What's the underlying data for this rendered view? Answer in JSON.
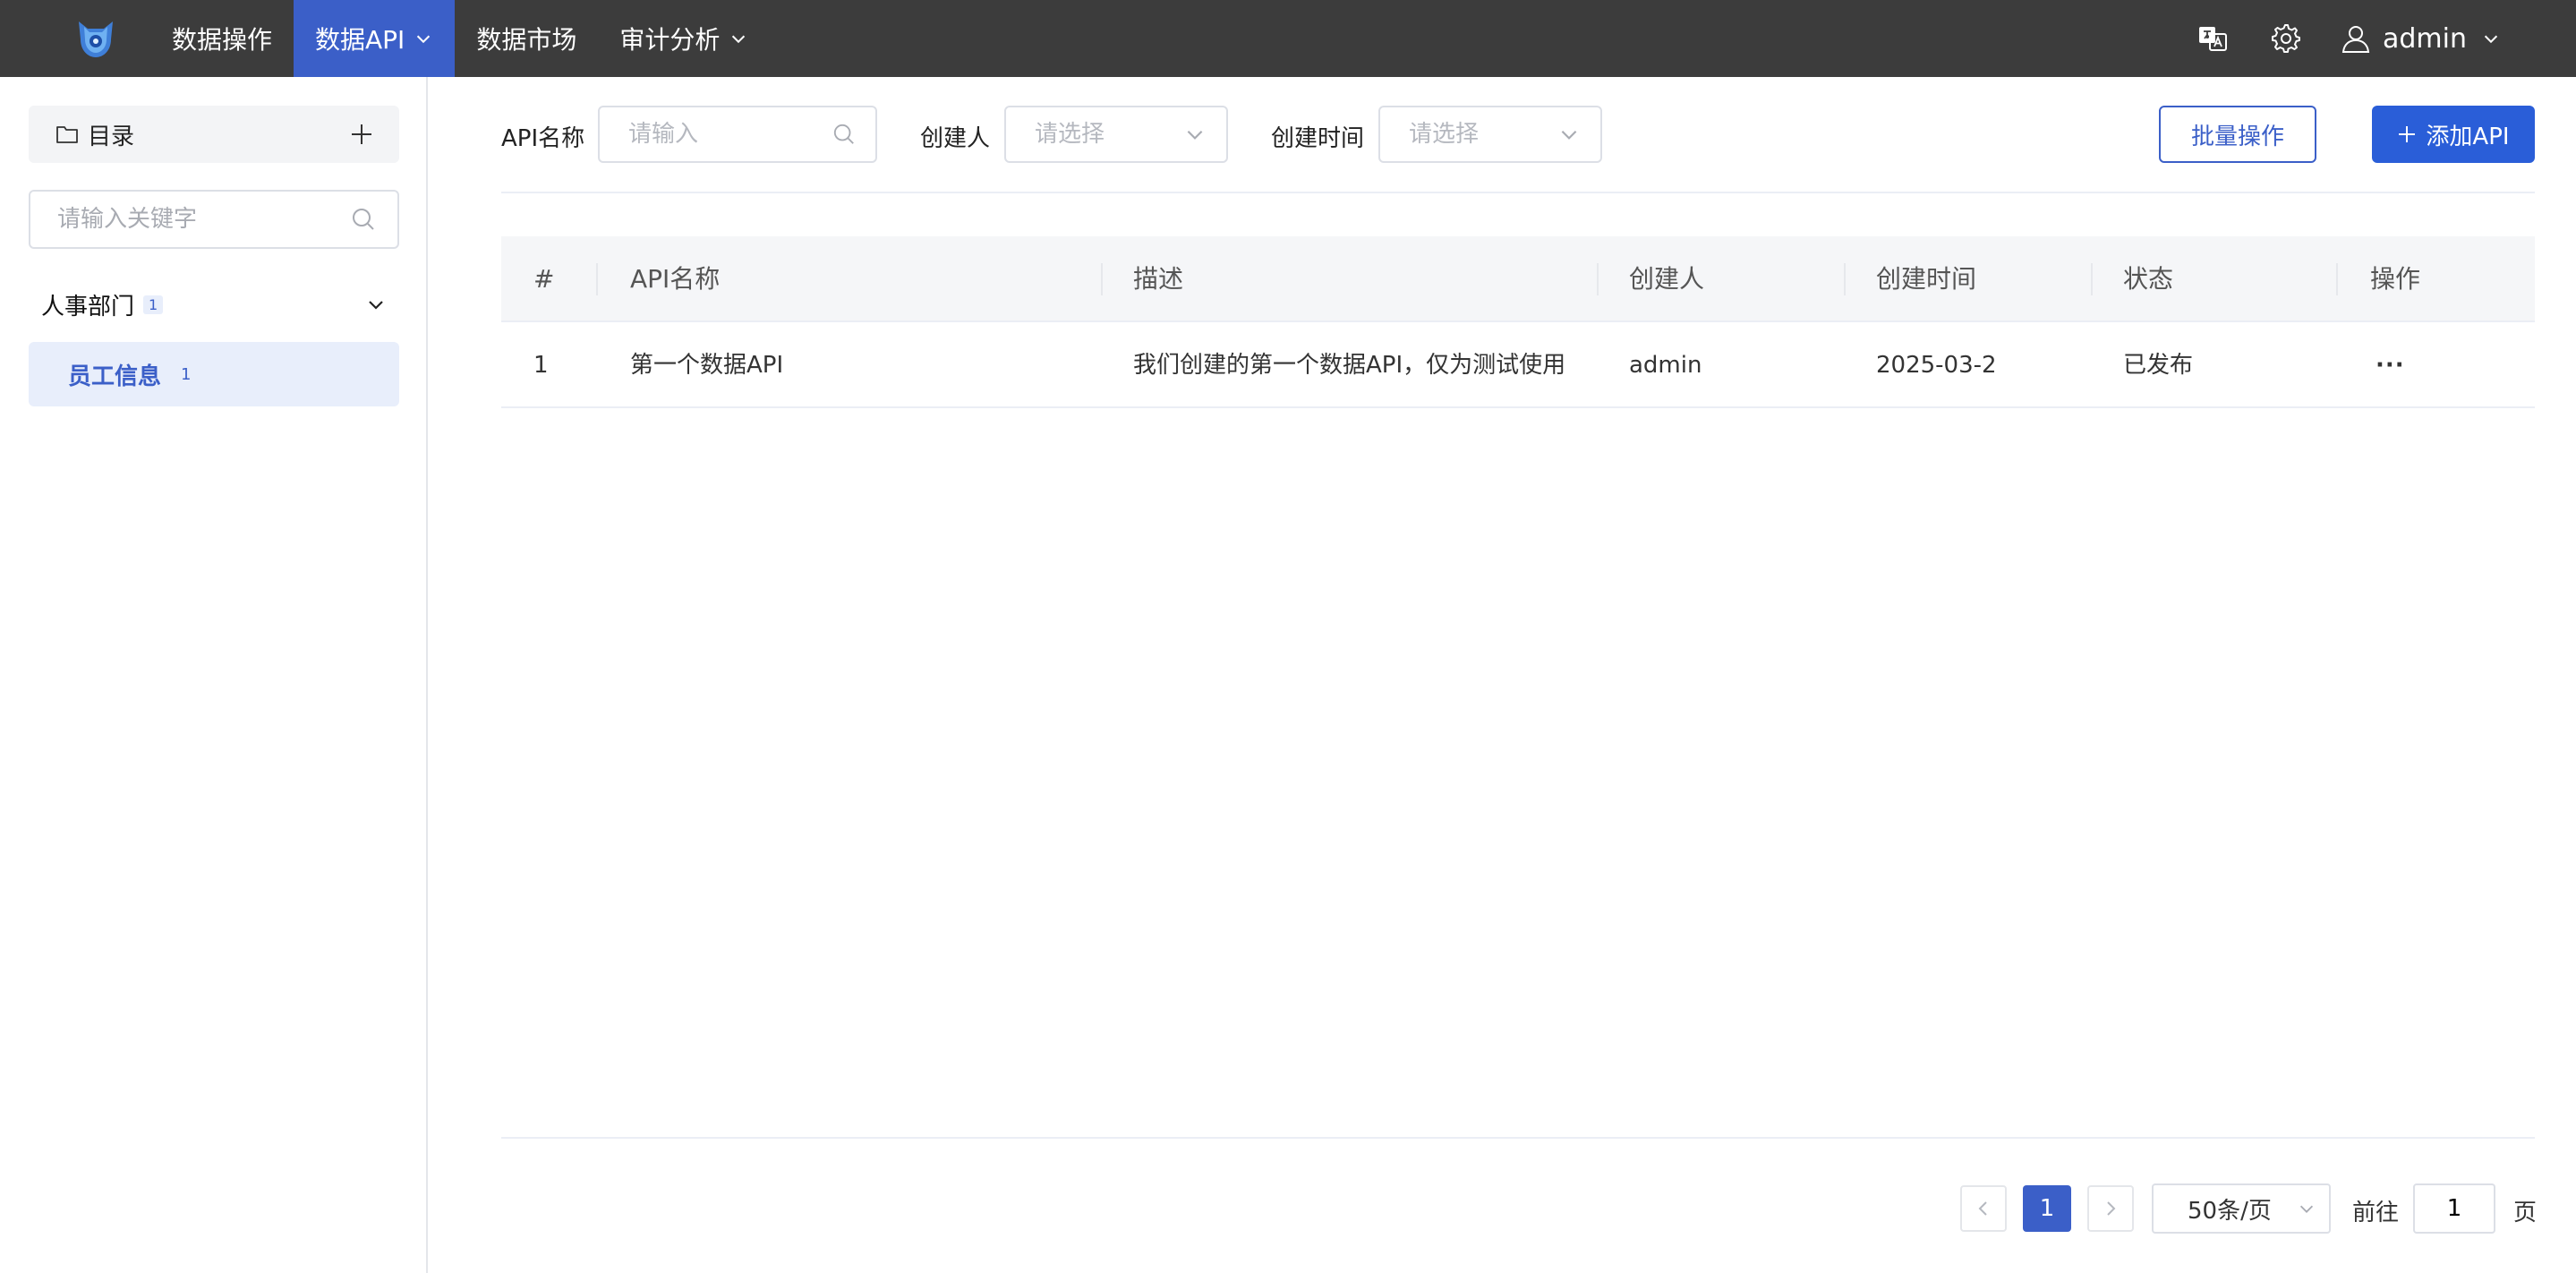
{
  "colors": {
    "nav_bg": "#3c3c3c",
    "accent": "#3b5fc8",
    "primary_button": "#2a5ed8"
  },
  "nav": {
    "items": [
      {
        "label": "数据操作",
        "active": false,
        "has_dropdown": false
      },
      {
        "label": "数据API",
        "active": true,
        "has_dropdown": true
      },
      {
        "label": "数据市场",
        "active": false,
        "has_dropdown": false
      },
      {
        "label": "审计分析",
        "active": false,
        "has_dropdown": true
      }
    ],
    "icons": [
      "translate-icon",
      "settings-icon",
      "user-icon"
    ],
    "user": "admin"
  },
  "sidebar": {
    "title": "目录",
    "search_placeholder": "请输入关键字",
    "groups": [
      {
        "name": "人事部门",
        "count": "1",
        "expanded": true,
        "children": [
          {
            "name": "员工信息",
            "count": "1",
            "selected": true
          }
        ]
      }
    ]
  },
  "filters": {
    "api_name": {
      "label": "API名称",
      "placeholder": "请输入"
    },
    "creator": {
      "label": "创建人",
      "placeholder": "请选择"
    },
    "created_time": {
      "label": "创建时间",
      "placeholder": "请选择"
    },
    "batch_button": "批量操作",
    "add_button": "添加API"
  },
  "table": {
    "columns": [
      "#",
      "API名称",
      "描述",
      "创建人",
      "创建时间",
      "状态",
      "操作"
    ],
    "rows": [
      {
        "index": "1",
        "name": "第一个数据API",
        "description": "我们创建的第一个数据API，仅为测试使用",
        "creator": "admin",
        "created_time": "2025-03-2",
        "status": "已发布",
        "action": "···"
      }
    ]
  },
  "pagination": {
    "current_page": "1",
    "page_size": "50条/页",
    "goto_label": "前往",
    "goto_value": "1",
    "page_unit": "页"
  }
}
